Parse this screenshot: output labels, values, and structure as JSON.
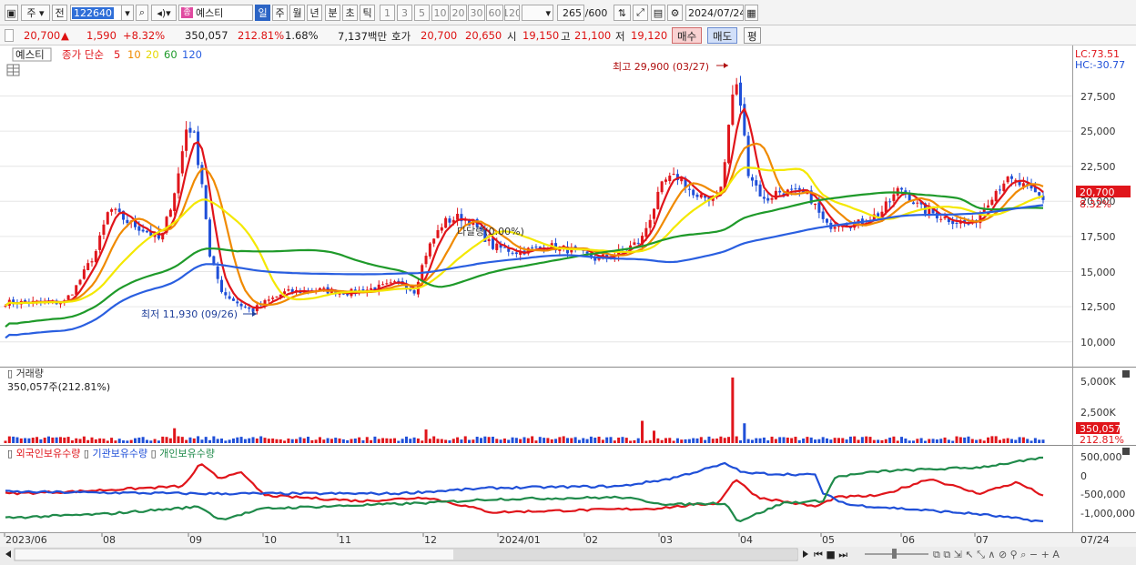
{
  "toolbar": {
    "period_type": "주",
    "prev_label": "전",
    "stock_code": "122640",
    "stock_name": "예스티",
    "name_tag": "종",
    "tf_day": "일",
    "tf_week": "주",
    "tf_month": "월",
    "tf_year": "년",
    "tf_min": "분",
    "tf_sec": "초",
    "tf_tick": "틱",
    "intervals": [
      "1",
      "3",
      "5",
      "10",
      "20",
      "30",
      "60",
      "120"
    ],
    "count_value": "265",
    "count_total": "/600",
    "date_value": "2024/07/24"
  },
  "infobar": {
    "price": "20,700",
    "change_arrow": "▲",
    "change": "1,590",
    "change_pct": "+8.32%",
    "volume": "350,057",
    "volume_pct": "212.81%",
    "turnover": "1.68%",
    "amount": "7,137백만",
    "ask_label": "호가",
    "ask": "20,700",
    "bid": "20,650",
    "open_label": "시",
    "open": "19,150",
    "high_label": "고",
    "high": "21,100",
    "low_label": "저",
    "low": "19,120",
    "buy_label": "매수",
    "sell_label": "매도",
    "avg_label": "평"
  },
  "chart": {
    "legend_stock": "예스티",
    "legend_price_type": "종가 단순",
    "ma_periods": [
      "5",
      "10",
      "20",
      "60",
      "120"
    ],
    "lc_label": "LC:73.51",
    "hc_label": "HC:-30.77",
    "y_ticks": [
      "27,500",
      "25,000",
      "22,500",
      "20,000",
      "17,500",
      "15,000",
      "12,500",
      "10,000"
    ],
    "price_tag": "20,700",
    "price_tag_pct": "8.32%",
    "high_annotation": "최고 29,900 (03/27)",
    "low_annotation": "최저 11,930 (09/26)",
    "ma_annotation": "다달량(0.00%)",
    "volume_title": "거래량",
    "volume_info": "350,057주(212.81%)",
    "volume_ticks": [
      "5,000K",
      "2,500K"
    ],
    "volume_tag": "350,057",
    "volume_tag_pct": "212.81%",
    "investor_titles": [
      "외국인보유수량",
      "기관보유수량",
      "개인보유수량"
    ],
    "investor_ticks": [
      "500,000",
      "0",
      "-500,000",
      "-1,000,000"
    ],
    "x_labels": [
      "2023/06",
      "08",
      "09",
      "10",
      "11",
      "12",
      "2024/01",
      "02",
      "03",
      "04",
      "05",
      "06",
      "07"
    ],
    "x_last": "07/24"
  },
  "colors": {
    "up": "#e0151b",
    "down": "#1f4fd8",
    "ma5": "#e0151b",
    "ma10": "#f08a00",
    "ma20": "#f4e800",
    "ma60": "#1f9a2a",
    "ma120": "#2a5fe0"
  }
}
